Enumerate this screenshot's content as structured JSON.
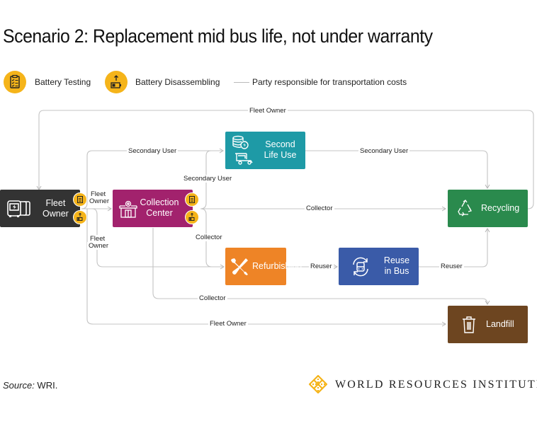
{
  "title": "Scenario 2: Replacement mid bus life, not under warranty",
  "legend": {
    "items": [
      {
        "icon": "clipboard-checklist-icon",
        "label": "Battery Testing"
      },
      {
        "icon": "battery-disassembling-icon",
        "label": "Battery Disassembling"
      },
      {
        "icon": "line-icon",
        "label": "Party responsible for transportation costs"
      }
    ]
  },
  "nodes": {
    "fleet_owner": {
      "label_line1": "Fleet",
      "label_line2": "Owner",
      "color": "#333333",
      "icon": "electric-buses-icon"
    },
    "collection_center": {
      "label_line1": "Collection",
      "label_line2": "Center",
      "color": "#a2226d",
      "icon": "building-gear-icon"
    },
    "second_life_use": {
      "label_line1": "Second",
      "label_line2": "Life Use",
      "color": "#1e9aa6",
      "icon": "battery-stack-rickshaw-icon"
    },
    "refurbishing": {
      "label": "Refurbishing",
      "color": "#ee8426",
      "icon": "wrench-screwdriver-icon"
    },
    "reuse_in_bus": {
      "label_line1": "Reuse",
      "label_line2": "in Bus",
      "color": "#3a5ba8",
      "icon": "bus-cycle-icon"
    },
    "recycling": {
      "label": "Recycling",
      "color": "#2a8a4d",
      "icon": "recycle-icon"
    },
    "landfill": {
      "label": "Landfill",
      "color": "#6d4520",
      "icon": "trash-bin-icon"
    }
  },
  "connections": {
    "fleet_owner_top": "Fleet Owner",
    "secondary_user_top": "Secondary User",
    "secondary_user_to_recycling": "Secondary User",
    "secondary_user_vertical": "Secondary User",
    "fleet_owner_to_cc_line1": "Fleet",
    "fleet_owner_to_cc_line2": "Owner",
    "collector_to_recycling": "Collector",
    "fleet_owner_down_line1": "Fleet",
    "fleet_owner_down_line2": "Owner",
    "collector_to_refurbishing": "Collector",
    "reuser_refurb_to_reuse": "Reuser",
    "reuser_reuse_to_recycling": "Reuser",
    "collector_to_landfill": "Collector",
    "fleet_owner_to_landfill": "Fleet Owner"
  },
  "footer": {
    "source_label": "Source:",
    "source_value": " WRI.",
    "logo_text": "WORLD RESOURCES INSTITUTE"
  }
}
